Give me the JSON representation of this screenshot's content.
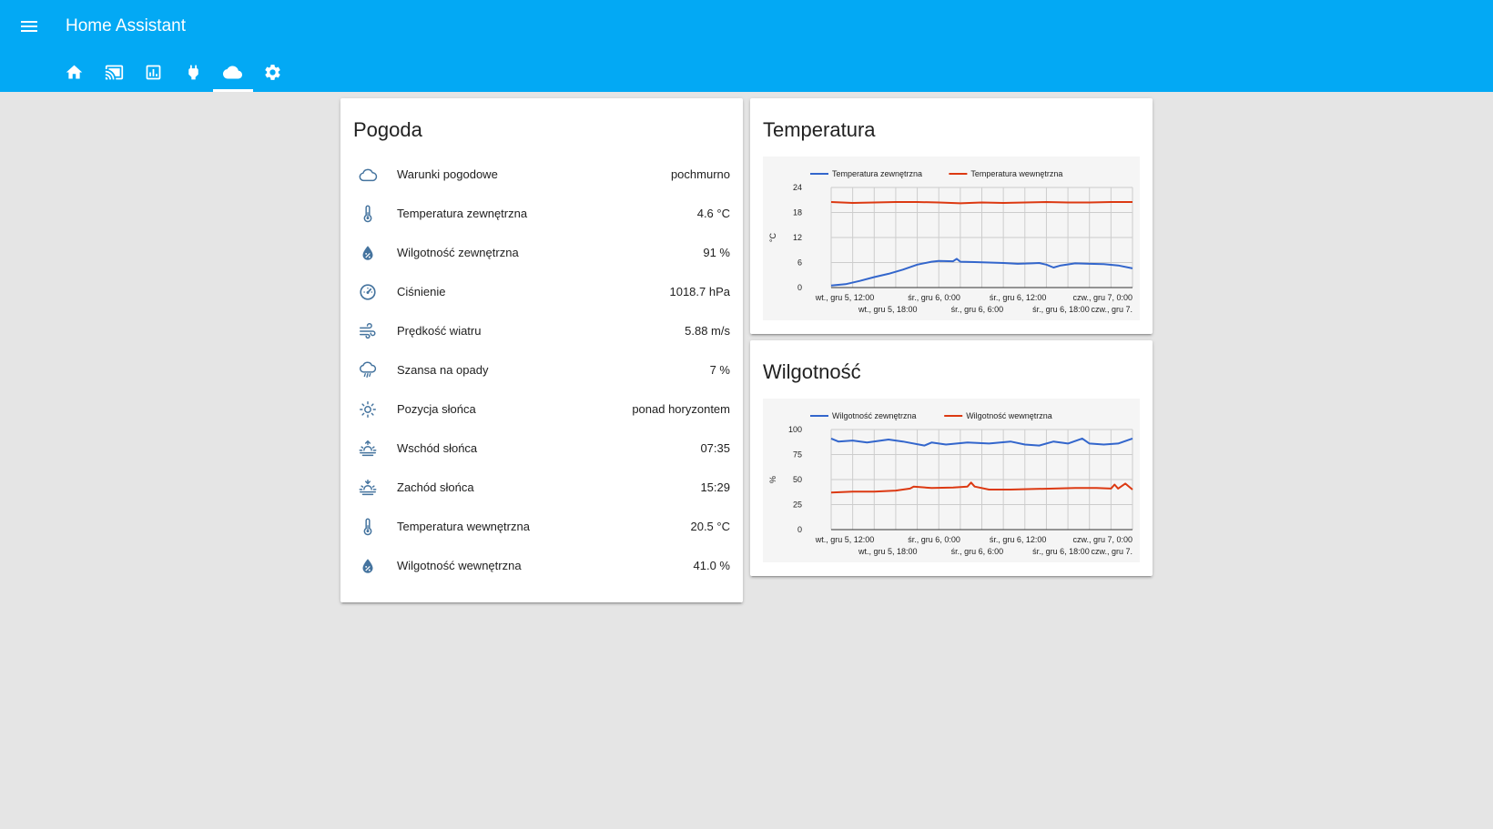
{
  "app": {
    "title": "Home Assistant"
  },
  "tabs": [
    {
      "icon": "home-icon"
    },
    {
      "icon": "cast-icon"
    },
    {
      "icon": "chart-icon"
    },
    {
      "icon": "plug-icon"
    },
    {
      "icon": "cloud-icon",
      "active": true
    },
    {
      "icon": "gear-icon"
    }
  ],
  "colors": {
    "primary": "#03a9f4",
    "icon": "#44739e",
    "outdoor": "#3366cc",
    "indoor": "#dc3912"
  },
  "pogoda": {
    "title": "Pogoda",
    "rows": [
      {
        "icon": "cloud-outline-icon",
        "name": "Warunki pogodowe",
        "value": "pochmurno"
      },
      {
        "icon": "thermometer-icon",
        "name": "Temperatura zewnętrzna",
        "value": "4.6 °C"
      },
      {
        "icon": "water-percent-icon",
        "name": "Wilgotność zewnętrzna",
        "value": "91 %"
      },
      {
        "icon": "gauge-icon",
        "name": "Ciśnienie",
        "value": "1018.7 hPa"
      },
      {
        "icon": "wind-icon",
        "name": "Prędkość wiatru",
        "value": "5.88 m/s"
      },
      {
        "icon": "rain-icon",
        "name": "Szansa na opady",
        "value": "7 %"
      },
      {
        "icon": "sun-icon",
        "name": "Pozycja słońca",
        "value": "ponad horyzontem"
      },
      {
        "icon": "sunrise-icon",
        "name": "Wschód słońca",
        "value": "07:35"
      },
      {
        "icon": "sunset-icon",
        "name": "Zachód słońca",
        "value": "15:29"
      },
      {
        "icon": "thermometer-icon",
        "name": "Temperatura wewnętrzna",
        "value": "20.5 °C"
      },
      {
        "icon": "water-percent-icon",
        "name": "Wilgotność wewnętrzna",
        "value": "41.0 %"
      }
    ]
  },
  "chart_data": [
    {
      "type": "line",
      "title": "Temperatura",
      "ylabel": "°C",
      "ylim": [
        0,
        24
      ],
      "yticks": [
        0,
        6,
        12,
        18,
        24
      ],
      "xlim": [
        0,
        42
      ],
      "xticks_top": [
        {
          "x": 6,
          "label": "wt., gru 5, 12:00"
        },
        {
          "x": 18,
          "label": "śr., gru 6, 0:00"
        },
        {
          "x": 30,
          "label": "śr., gru 6, 12:00"
        },
        {
          "x": 42,
          "label": "czw., gru 7, 0:00"
        }
      ],
      "xticks_bottom": [
        {
          "x": 12,
          "label": "wt., gru 5, 18:00"
        },
        {
          "x": 24,
          "label": "śr., gru 6, 6:00"
        },
        {
          "x": 36,
          "label": "śr., gru 6, 18:00"
        },
        {
          "x": 48,
          "label": "czw., gru 7."
        }
      ],
      "grid": true,
      "legend": "top",
      "series": [
        {
          "name": "Temperatura zewnętrzna",
          "color": "#3366cc",
          "x": [
            0,
            2,
            4,
            6,
            8,
            10,
            12,
            14,
            15,
            17,
            17.5,
            18,
            20,
            22,
            24,
            26,
            28,
            29,
            30,
            31,
            32,
            34,
            36,
            38,
            40,
            42
          ],
          "y": [
            0.5,
            0.8,
            1.6,
            2.5,
            3.3,
            4.3,
            5.5,
            6.2,
            6.4,
            6.3,
            6.9,
            6.2,
            6.1,
            6.0,
            5.9,
            5.7,
            5.8,
            5.9,
            5.5,
            4.8,
            5.3,
            5.8,
            5.7,
            5.6,
            5.3,
            4.6
          ]
        },
        {
          "name": "Temperatura wewnętrzna",
          "color": "#dc3912",
          "x": [
            0,
            3,
            6,
            9,
            12,
            15,
            18,
            21,
            24,
            27,
            30,
            33,
            36,
            39,
            42
          ],
          "y": [
            20.5,
            20.3,
            20.4,
            20.5,
            20.5,
            20.4,
            20.2,
            20.4,
            20.3,
            20.4,
            20.5,
            20.4,
            20.4,
            20.5,
            20.5
          ]
        }
      ]
    },
    {
      "type": "line",
      "title": "Wilgotność",
      "ylabel": "%",
      "ylim": [
        0,
        100
      ],
      "yticks": [
        0,
        25,
        50,
        75,
        100
      ],
      "xlim": [
        0,
        42
      ],
      "xticks_top": [
        {
          "x": 6,
          "label": "wt., gru 5, 12:00"
        },
        {
          "x": 18,
          "label": "śr., gru 6, 0:00"
        },
        {
          "x": 30,
          "label": "śr., gru 6, 12:00"
        },
        {
          "x": 42,
          "label": "czw., gru 7, 0:00"
        }
      ],
      "xticks_bottom": [
        {
          "x": 12,
          "label": "wt., gru 5, 18:00"
        },
        {
          "x": 24,
          "label": "śr., gru 6, 6:00"
        },
        {
          "x": 36,
          "label": "śr., gru 6, 18:00"
        },
        {
          "x": 48,
          "label": "czw., gru 7."
        }
      ],
      "grid": true,
      "legend": "top",
      "series": [
        {
          "name": "Wilgotność zewnętrzna",
          "color": "#3366cc",
          "x": [
            0,
            1,
            3,
            5,
            8,
            10,
            13,
            14,
            16,
            19,
            22,
            25,
            27,
            29,
            31,
            33,
            35,
            36,
            38,
            40,
            42
          ],
          "y": [
            91,
            88,
            89,
            87,
            90,
            88,
            84,
            87,
            85,
            87,
            86,
            88,
            85,
            84,
            88,
            86,
            91,
            86,
            85,
            86,
            91
          ]
        },
        {
          "name": "Wilgotność wewnętrzna",
          "color": "#dc3912",
          "x": [
            0,
            3,
            6,
            9,
            11,
            11.5,
            14,
            17,
            19,
            19.5,
            20,
            22,
            25,
            28,
            31,
            34,
            37,
            39,
            39.5,
            40,
            41,
            42
          ],
          "y": [
            37,
            38,
            38,
            39,
            41,
            43,
            41.5,
            42,
            43,
            47,
            43,
            40,
            40,
            40.5,
            41,
            41.5,
            41.5,
            41,
            45,
            41,
            46,
            40
          ]
        }
      ]
    }
  ]
}
